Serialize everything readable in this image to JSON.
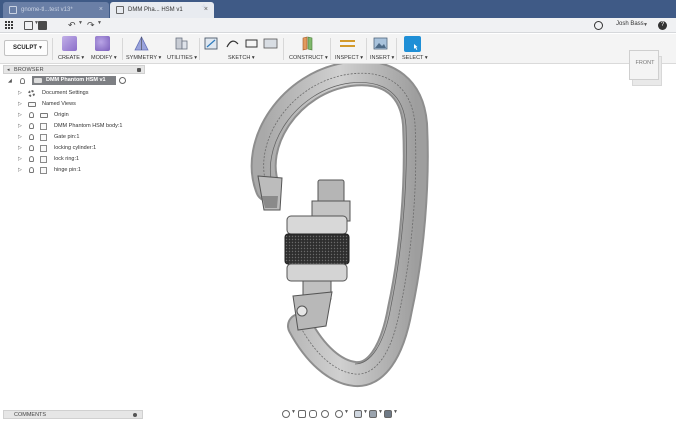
{
  "tabs": [
    {
      "label": "gnome-tl...test v13*"
    },
    {
      "label": "DMM Pha... HSM v1"
    }
  ],
  "tab_close_glyph": "×",
  "new_tab_glyph": "+",
  "quickbar": {
    "undo_glyph": "↶",
    "redo_glyph": "↷",
    "user_name": "Josh Bass",
    "help_glyph": "?"
  },
  "ribbon": {
    "workspace": "SCULPT",
    "groups": [
      {
        "label": "CREATE ▾",
        "icon": "box-icon",
        "color": "#9b7fd0"
      },
      {
        "label": "MODIFY ▾",
        "icon": "modify-icon",
        "color": "#8a6fc2"
      },
      {
        "label": "SYMMETRY ▾",
        "icon": "symmetry-icon",
        "color": "#7e89c9"
      },
      {
        "label": "UTILITIES ▾",
        "icon": "utilities-icon",
        "color": "#7c8696"
      },
      {
        "label": "SKETCH ▾",
        "icon": "sketch-icon",
        "color": "#5f6b7a"
      },
      {
        "label": "CONSTRUCT ▾",
        "icon": "construct-icon",
        "color": "#d9824a"
      },
      {
        "label": "INSPECT ▾",
        "icon": "inspect-icon",
        "color": "#d9a43a"
      },
      {
        "label": "INSERT ▾",
        "icon": "insert-icon",
        "color": "#6f8fb0"
      },
      {
        "label": "SELECT ▾",
        "icon": "select-icon",
        "color": "#1f8fd6"
      }
    ]
  },
  "browser": {
    "title": "BROWSER",
    "root": "DMM Phantom HSM v1",
    "items": [
      {
        "label": "Document Settings"
      },
      {
        "label": "Named Views"
      },
      {
        "label": "Origin"
      },
      {
        "label": "DMM Phantom HSM body:1"
      },
      {
        "label": "Gate pin:1"
      },
      {
        "label": "locking cylinder:1"
      },
      {
        "label": "lock ring:1"
      },
      {
        "label": "hinge pin:1"
      }
    ]
  },
  "comments": {
    "title": "COMMENTS"
  },
  "viewcube": {
    "face": "FRONT"
  },
  "colors": {
    "tabbar": "#3f5a86",
    "select_accent": "#1f8fd6",
    "model_gray": "#b9b9b9",
    "knurl_dark": "#3a3a3a"
  }
}
